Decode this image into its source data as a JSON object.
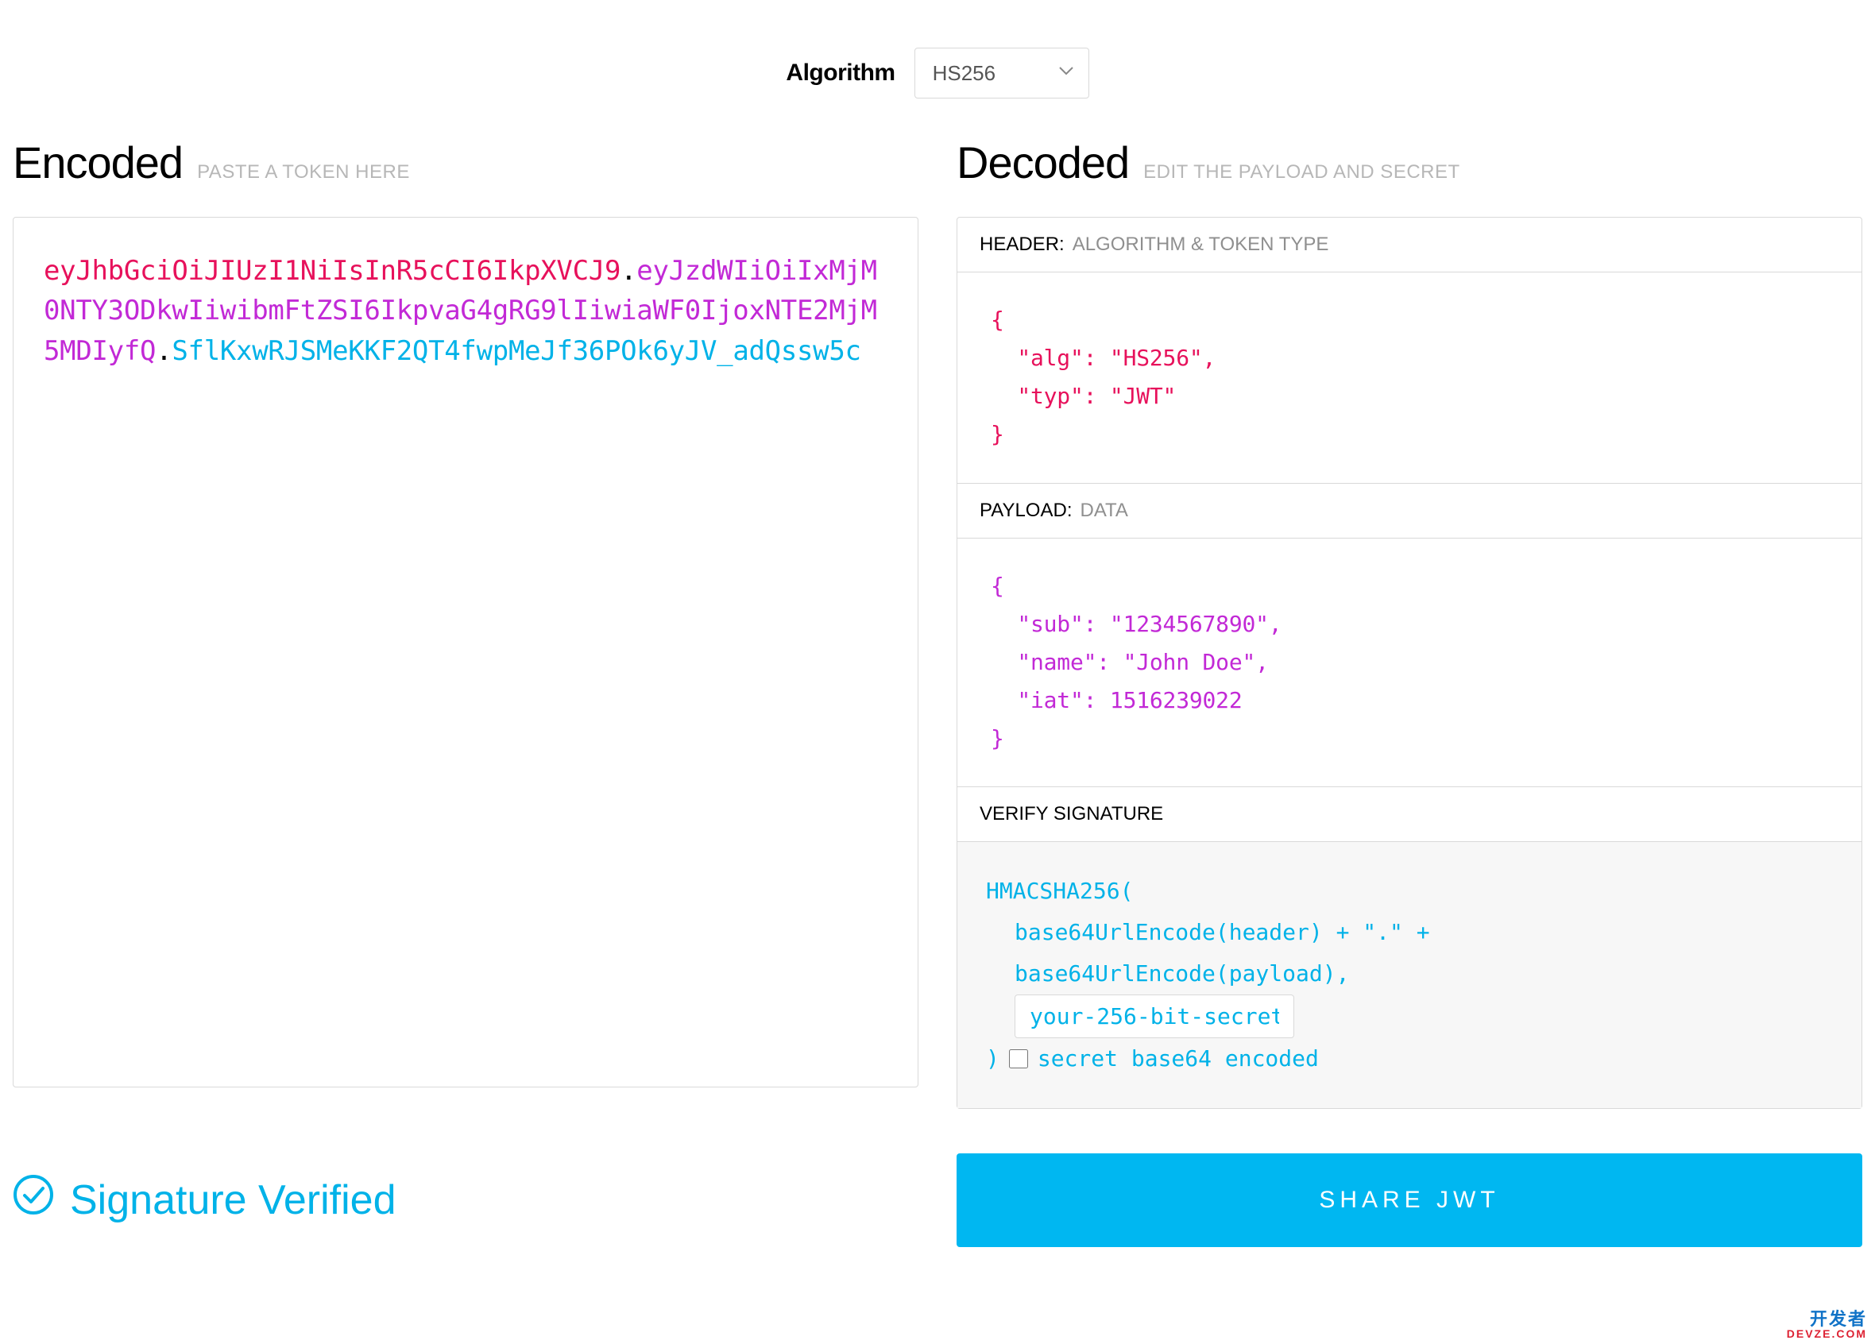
{
  "algorithm": {
    "label": "Algorithm",
    "selected": "HS256"
  },
  "encoded": {
    "title": "Encoded",
    "subtitle": "PASTE A TOKEN HERE",
    "token": {
      "header": "eyJhbGciOiJIUzI1NiIsInR5cCI6IkpXVCJ9",
      "payload": "eyJzdWIiOiIxMjM0NTY3ODkwIiwibmFtZSI6IkpvaG4gRG9lIiwiaWF0IjoxNTE2MjM5MDIyfQ",
      "signature": "SflKxwRJSMeKKF2QT4fwpMeJf36POk6yJV_adQssw5c"
    }
  },
  "decoded": {
    "title": "Decoded",
    "subtitle": "EDIT THE PAYLOAD AND SECRET",
    "header_section": {
      "label": "HEADER:",
      "desc": "ALGORITHM & TOKEN TYPE",
      "json": "{\n  \"alg\": \"HS256\",\n  \"typ\": \"JWT\"\n}"
    },
    "payload_section": {
      "label": "PAYLOAD:",
      "desc": "DATA",
      "json": "{\n  \"sub\": \"1234567890\",\n  \"name\": \"John Doe\",\n  \"iat\": 1516239022\n}"
    },
    "signature_section": {
      "label": "VERIFY SIGNATURE",
      "line1": "HMACSHA256(",
      "line2": "base64UrlEncode(header) + \".\" +",
      "line3": "base64UrlEncode(payload),",
      "secret_value": "your-256-bit-secret",
      "line4_close": ")",
      "checkbox_label": "secret base64 encoded",
      "checkbox_checked": false
    }
  },
  "footer": {
    "verified_text": "Signature Verified",
    "share_label": "SHARE JWT"
  },
  "watermark": {
    "l1": "开发者",
    "l2": "DEVZE.COM"
  }
}
